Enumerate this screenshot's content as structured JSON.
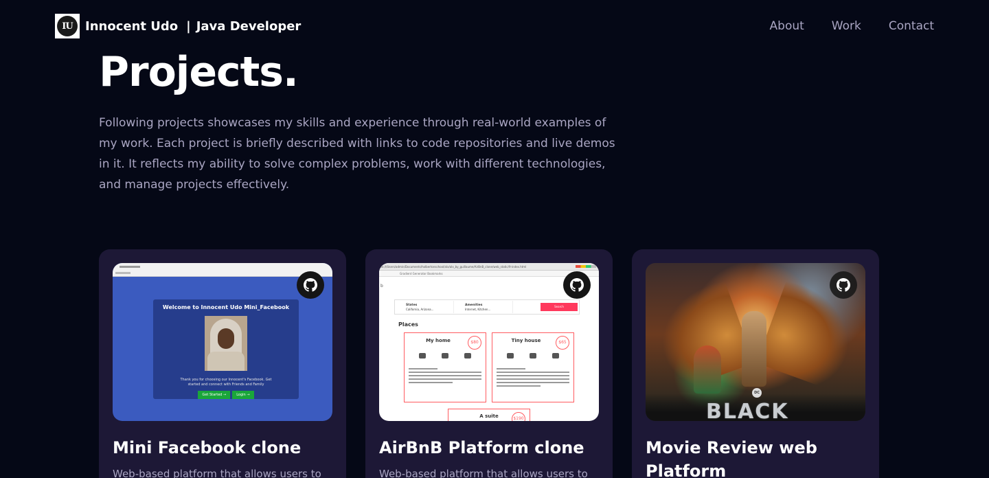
{
  "nav": {
    "logo_text": "IU",
    "name": "Innocent Udo",
    "separator": "|",
    "role": "Java Developer",
    "links": [
      "About",
      "Work",
      "Contact"
    ]
  },
  "section": {
    "title": "Projects.",
    "intro": "Following projects showcases my skills and experience through real-world examples of my work. Each project is briefly described with links to code repositories and live demos in it. It reflects my ability to solve complex problems, work with different technologies, and manage projects effectively."
  },
  "projects": [
    {
      "title": "Mini Facebook clone",
      "description": "Web-based platform that allows users to",
      "icon": "github-icon",
      "thumbnail": {
        "welcome": "Welcome to Innocent Udo Mini_Facebook",
        "message": "Thank you for choosing our Innocent's Facebook. Get started and connect with Friends and Family",
        "button_start": "Get Started →",
        "button_login": "Login →"
      }
    },
    {
      "title": "AirBnB Platform clone",
      "description": "Web-based platform that allows users to",
      "icon": "github-icon",
      "thumbnail": {
        "url": "file:///Users/admin/Documents/holbertonschool/alx/alx_by_guillaume/AirBnB_clone/web_static/9-index.html",
        "bookmarks": "Gradient Generator   Bookmarks",
        "b": "b",
        "states_label": "States",
        "states_value": "California, Arizona...",
        "amenities_label": "Amenities",
        "amenities_value": "Internet, Kitchen...",
        "search": "Search",
        "places": "Places",
        "place1": "My home",
        "price1": "$80",
        "place2": "Tiny house",
        "price2": "$65",
        "place3": "A suite",
        "price3": "$190"
      }
    },
    {
      "title": "Movie Review web Platform",
      "description": "",
      "icon": "github-icon",
      "thumbnail": {
        "poster_title": "BLACK",
        "dc": "DC"
      }
    }
  ],
  "colors": {
    "background": "#050816",
    "card": "#1d1836",
    "secondary_text": "#aaa6c3"
  }
}
